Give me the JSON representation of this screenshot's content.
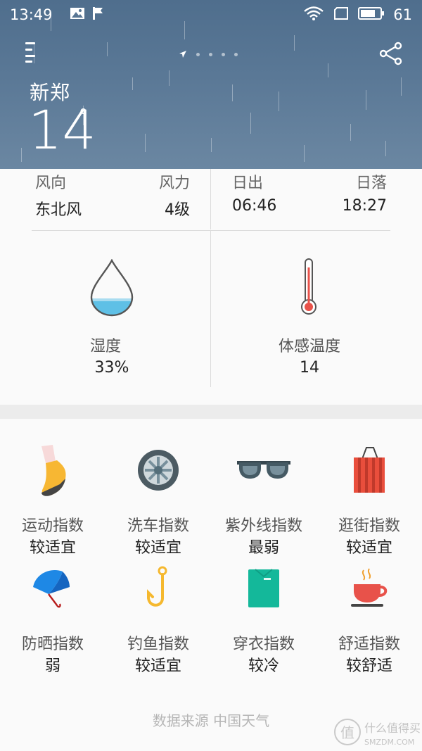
{
  "status_bar": {
    "time": "13:49",
    "battery": "61",
    "icons_left": [
      "image-icon",
      "flag-icon"
    ],
    "icons_right": [
      "wifi-icon",
      "sim-icon",
      "battery-icon"
    ]
  },
  "header": {
    "city": "新郑",
    "temperature": "14",
    "degree_symbol": "°",
    "page_count": 5,
    "current_page": 0,
    "background_color": "#587694"
  },
  "details": {
    "wind_direction_label": "风向",
    "wind_direction_value": "东北风",
    "wind_force_label": "风力",
    "wind_force_value": "4级",
    "sunrise_label": "日出",
    "sunrise_value": "06:46",
    "sunset_label": "日落",
    "sunset_value": "18:27",
    "humidity_label": "湿度",
    "humidity_value": "33%",
    "feels_like_label": "体感温度",
    "feels_like_value": "14"
  },
  "indices": [
    {
      "icon": "running-shoe-icon",
      "name": "运动指数",
      "value": "较适宜"
    },
    {
      "icon": "car-wheel-icon",
      "name": "洗车指数",
      "value": "较适宜"
    },
    {
      "icon": "sunglasses-icon",
      "name": "紫外线指数",
      "value": "最弱"
    },
    {
      "icon": "shopping-bag-icon",
      "name": "逛街指数",
      "value": "较适宜"
    },
    {
      "icon": "umbrella-icon",
      "name": "防晒指数",
      "value": "弱"
    },
    {
      "icon": "fishing-hook-icon",
      "name": "钓鱼指数",
      "value": "较适宜"
    },
    {
      "icon": "clothing-icon",
      "name": "穿衣指数",
      "value": "较冷"
    },
    {
      "icon": "coffee-cup-icon",
      "name": "舒适指数",
      "value": "较舒适"
    }
  ],
  "footer": {
    "source": "数据来源 中国天气",
    "watermark_text": "什么值得买",
    "watermark_domain": "SMZDM.COM",
    "watermark_logo": "值"
  }
}
